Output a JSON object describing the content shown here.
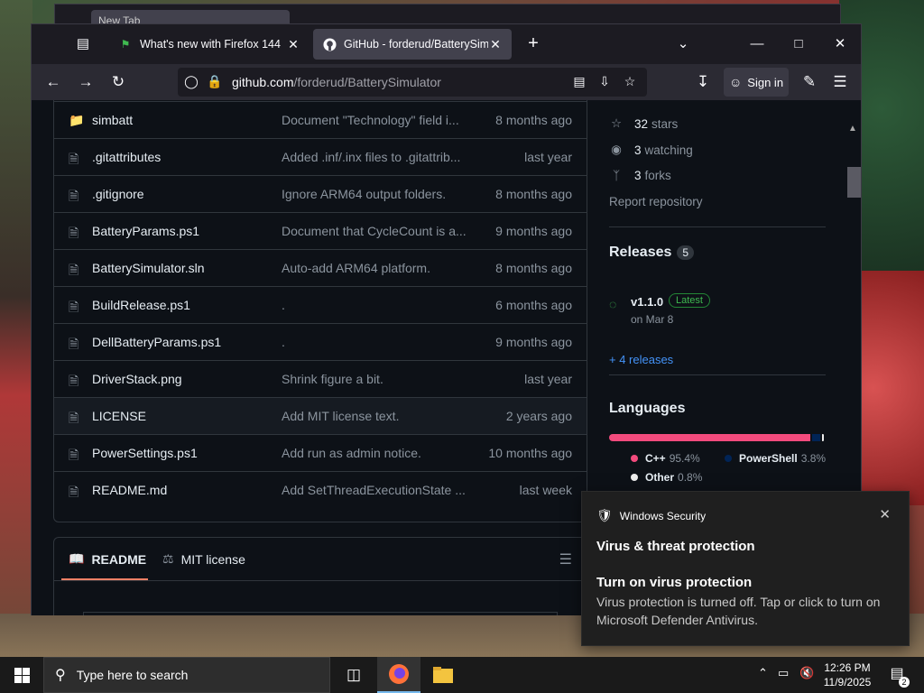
{
  "browser": {
    "tabs": [
      {
        "label": "What's new with Firefox 144",
        "active": false
      },
      {
        "label": "GitHub - forderud/BatterySimulator",
        "active": true
      }
    ],
    "url_domain": "github.com",
    "url_path": "/forderud/BatterySimulator",
    "sign_in": "Sign in"
  },
  "files": [
    {
      "name": "simbatt",
      "type": "folder",
      "message": "Document \"Technology\" field i...",
      "age": "8 months ago"
    },
    {
      "name": ".gitattributes",
      "type": "file",
      "message": "Added .inf/.inx files to .gitattrib...",
      "age": "last year"
    },
    {
      "name": ".gitignore",
      "type": "file",
      "message": "Ignore ARM64 output folders.",
      "age": "8 months ago"
    },
    {
      "name": "BatteryParams.ps1",
      "type": "file",
      "message": "Document that CycleCount is a...",
      "age": "9 months ago"
    },
    {
      "name": "BatterySimulator.sln",
      "type": "file",
      "message": "Auto-add ARM64 platform.",
      "age": "8 months ago"
    },
    {
      "name": "BuildRelease.ps1",
      "type": "file",
      "message": ".",
      "age": "6 months ago"
    },
    {
      "name": "DellBatteryParams.ps1",
      "type": "file",
      "message": ".",
      "age": "9 months ago"
    },
    {
      "name": "DriverStack.png",
      "type": "file",
      "message": "Shrink figure a bit.",
      "age": "last year"
    },
    {
      "name": "LICENSE",
      "type": "file",
      "message": "Add MIT license text.",
      "age": "2 years ago"
    },
    {
      "name": "PowerSettings.ps1",
      "type": "file",
      "message": "Add run as admin notice.",
      "age": "10 months ago"
    },
    {
      "name": "README.md",
      "type": "file",
      "message": "Add SetThreadExecutionState ...",
      "age": "last week"
    }
  ],
  "readme_tabs": {
    "readme": "README",
    "license": "MIT license"
  },
  "sidebar": {
    "stars_count": "32",
    "stars_label": "stars",
    "watching_count": "3",
    "watching_label": "watching",
    "forks_count": "3",
    "forks_label": "forks",
    "report": "Report repository",
    "releases_title": "Releases",
    "releases_count": "5",
    "release_version": "v1.1.0",
    "release_badge": "Latest",
    "release_date": "on Mar 8",
    "more_releases": "+ 4 releases",
    "languages_title": "Languages",
    "languages": [
      {
        "name": "C++",
        "pct": "95.4%",
        "color": "#f34b7d"
      },
      {
        "name": "PowerShell",
        "pct": "3.8%",
        "color": "#012456"
      },
      {
        "name": "Other",
        "pct": "0.8%",
        "color": "#ededed"
      }
    ]
  },
  "toast": {
    "app": "Windows Security",
    "title": "Virus & threat protection",
    "subtitle": "Turn on virus protection",
    "body": "Virus protection is turned off. Tap or click to turn on Microsoft Defender Antivirus."
  },
  "taskbar": {
    "search_placeholder": "Type here to search",
    "time": "12:26 PM",
    "date": "11/9/2025",
    "notifications": "2"
  },
  "background_tab": {
    "label": "New Tab"
  }
}
